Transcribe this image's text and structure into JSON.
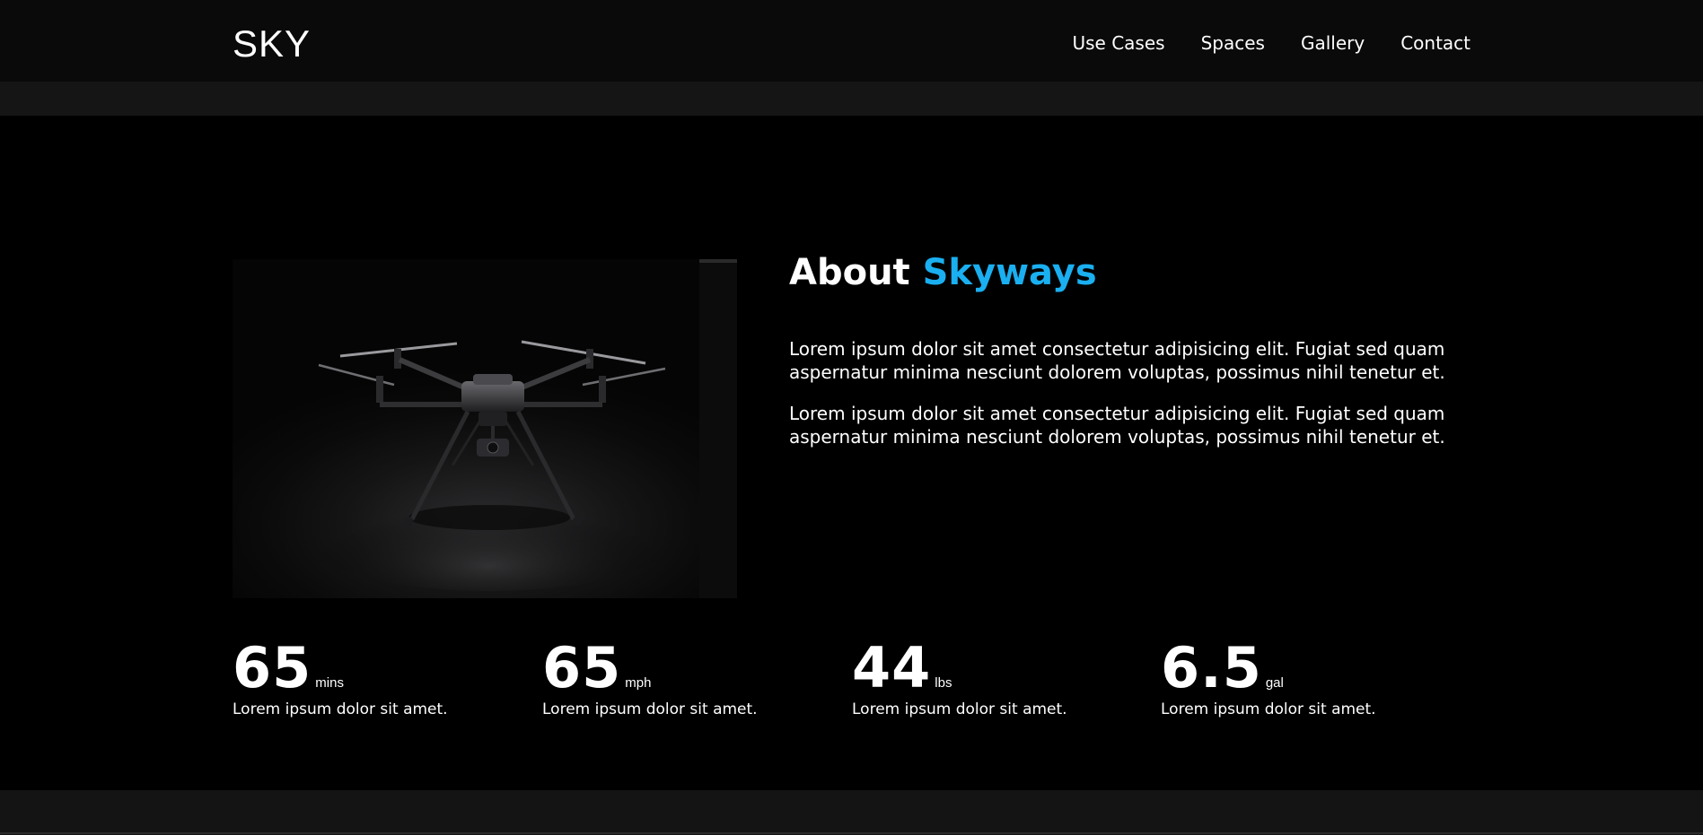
{
  "brand": {
    "name": "SKY"
  },
  "nav": {
    "items": [
      {
        "label": "Use Cases"
      },
      {
        "label": "Spaces"
      },
      {
        "label": "Gallery"
      },
      {
        "label": "Contact"
      }
    ]
  },
  "about": {
    "title_prefix": "About",
    "title_accent": "Skyways",
    "paragraphs": [
      "Lorem ipsum dolor sit amet consectetur adipisicing elit. Fugiat sed quam aspernatur minima nesciunt dolorem voluptas, possimus nihil tenetur et.",
      "Lorem ipsum dolor sit amet consectetur adipisicing elit. Fugiat sed quam aspernatur minima nesciunt dolorem voluptas, possimus nihil tenetur et."
    ],
    "image_icon": "drone-photo"
  },
  "stats": [
    {
      "value": "65",
      "unit": "mins",
      "desc": "Lorem ipsum dolor sit amet."
    },
    {
      "value": "65",
      "unit": "mph",
      "desc": "Lorem ipsum dolor sit amet."
    },
    {
      "value": "44",
      "unit": "lbs",
      "desc": "Lorem ipsum dolor sit amet."
    },
    {
      "value": "6.5",
      "unit": "gal",
      "desc": "Lorem ipsum dolor sit amet."
    }
  ],
  "colors": {
    "accent": "#1aaff0",
    "background": "#000000",
    "navbar": "#0a0a0b",
    "text": "#ffffff"
  }
}
